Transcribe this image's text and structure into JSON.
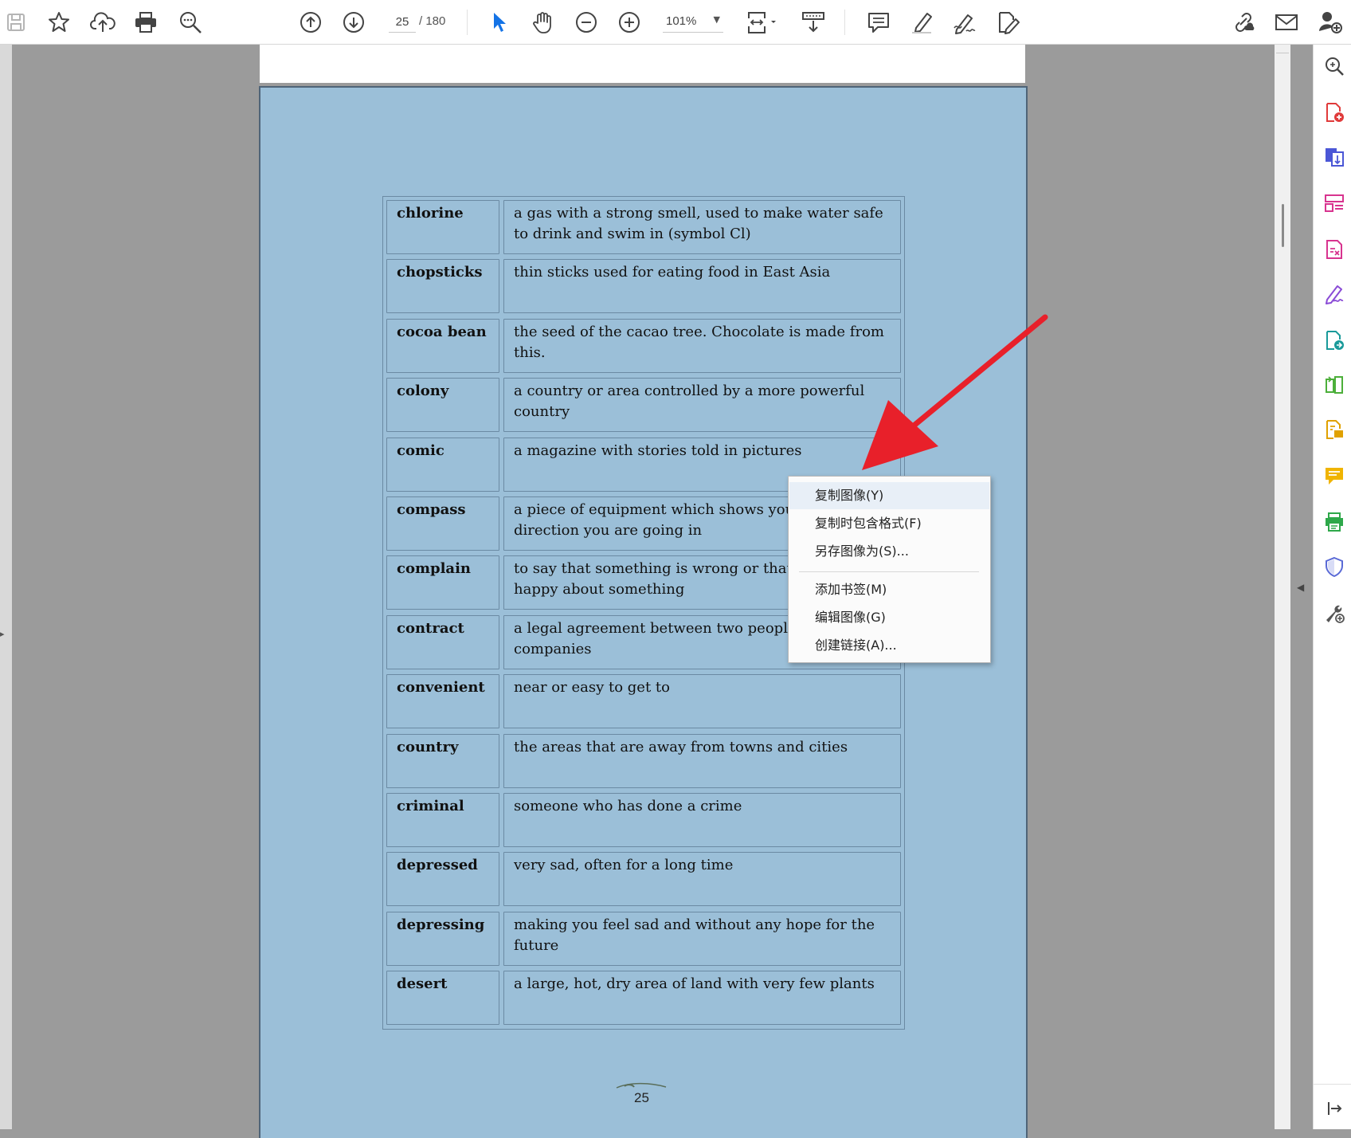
{
  "toolbar": {
    "page_current": "25",
    "page_total": "/ 180",
    "zoom": "101%",
    "icons": [
      "save-icon",
      "bookmark-star-icon",
      "upload-cloud-icon",
      "print-icon",
      "search-zoom-icon",
      "prev-page-icon",
      "next-page-icon",
      "select-arrow-icon",
      "hand-tool-icon",
      "zoom-out-icon",
      "zoom-in-icon",
      "fit-page-icon",
      "scroll-mode-icon",
      "comment-icon",
      "highlight-icon",
      "sign-icon",
      "edit-pdf-icon",
      "share-link-icon",
      "email-icon",
      "add-user-icon"
    ]
  },
  "document": {
    "entries": [
      {
        "term": "chlorine",
        "definition": "a gas with a strong smell, used to make water safe to drink and swim in (symbol Cl)"
      },
      {
        "term": "chopsticks",
        "definition": "thin sticks used for eating food in East Asia"
      },
      {
        "term": "cocoa bean",
        "definition": "the seed of the cacao tree. Chocolate is made from this."
      },
      {
        "term": "colony",
        "definition": "a country or area controlled by a more powerful country"
      },
      {
        "term": "comic",
        "definition": "a magazine with stories told in pictures"
      },
      {
        "term": "compass",
        "definition": "a piece of equipment which shows you which direction you are going in"
      },
      {
        "term": "complain",
        "definition": "to say that something is wrong or that you are not happy about something"
      },
      {
        "term": "contract",
        "definition": "a legal agreement between two people or companies"
      },
      {
        "term": "convenient",
        "definition": "near or easy to get to"
      },
      {
        "term": "country",
        "definition": "the areas that are away from towns and cities"
      },
      {
        "term": "criminal",
        "definition": "someone who has done a crime"
      },
      {
        "term": "depressed",
        "definition": "very sad, often for a long time"
      },
      {
        "term": "depressing",
        "definition": "making you feel sad and without any hope for the future"
      },
      {
        "term": "desert",
        "definition": "a large, hot, dry area of land with very few plants"
      }
    ],
    "page_number": "25"
  },
  "context_menu": {
    "items": [
      {
        "label": "复制图像(Y)",
        "highlighted": true
      },
      {
        "label": "复制时包含格式(F)"
      },
      {
        "label": "另存图像为(S)..."
      },
      {
        "label": "添加书签(M)"
      },
      {
        "label": "编辑图像(G)"
      },
      {
        "label": "创建链接(A)..."
      }
    ]
  },
  "right_pane": {
    "icons": [
      "enhance-scan-icon",
      "create-pdf-icon",
      "export-pdf-icon",
      "organize-pages-icon",
      "edit-pdf-icon",
      "fill-sign-icon",
      "send-for-review-icon",
      "compress-pdf-icon",
      "export-file-icon",
      "comment-icon",
      "print-production-icon",
      "protect-shield-icon",
      "more-tools-icon",
      "collapse-pane-icon"
    ]
  },
  "colors": {
    "page_background": "#9bbfd8",
    "arrow": "#e8202a",
    "accent_blue": "#1473e6"
  }
}
